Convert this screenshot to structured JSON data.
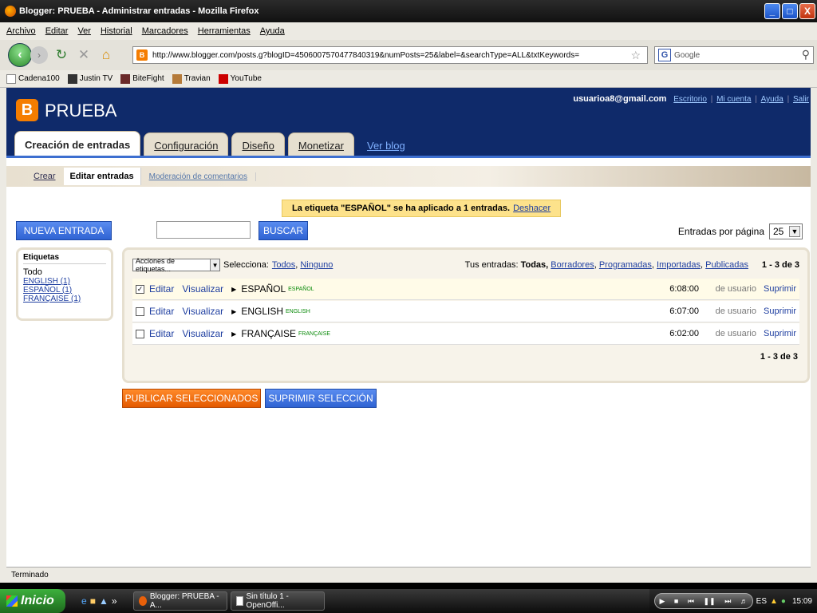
{
  "window": {
    "title": "Blogger: PRUEBA - Administrar entradas - Mozilla Firefox",
    "minimize": "_",
    "maximize": "□",
    "close": "X"
  },
  "menu": [
    "Archivo",
    "Editar",
    "Ver",
    "Historial",
    "Marcadores",
    "Herramientas",
    "Ayuda"
  ],
  "nav": {
    "url": "http://www.blogger.com/posts.g?blogID=4506007570477840319&numPosts=25&label=&searchType=ALL&txtKeywords=",
    "search_placeholder": "Google"
  },
  "bookmarks": [
    "Cadena100",
    "Justin TV",
    "BiteFight",
    "Travian",
    "YouTube"
  ],
  "blog": {
    "title": "PRUEBA",
    "user_email": "usuarioa8@gmail.com",
    "links": [
      "Escritorio",
      "Mi cuenta",
      "Ayuda",
      "Salir"
    ],
    "link_sep": "|"
  },
  "tabs": [
    "Creación de entradas",
    "Configuración",
    "Diseño",
    "Monetizar",
    "Ver blog"
  ],
  "subnav": [
    "Crear",
    "Editar entradas",
    "Moderación de comentarios"
  ],
  "notice": {
    "text": "La etiqueta \"ESPAÑOL\" se ha aplicado a 1 entradas.",
    "undo": "Deshacer"
  },
  "buttons": {
    "new_post": "NUEVA ENTRADA",
    "search": "BUSCAR",
    "publish_selected": "PUBLICAR SELECCIONADOS",
    "delete_selected": "SUPRIMIR SELECCIÓN"
  },
  "per_page": {
    "label": "Entradas por página",
    "value": "25"
  },
  "labels_box": {
    "header": "Etiquetas",
    "all": "Todo",
    "items": [
      "ENGLISH (1)",
      "ESPAÑOL (1)",
      "FRANÇAISE (1)"
    ]
  },
  "list": {
    "actions_select": "Acciones de etiquetas...",
    "select_label": "Selecciona:",
    "select_all": "Todos",
    "select_none": "Ninguno",
    "your_posts": "Tus entradas:",
    "filter_all": "Todas,",
    "filters": [
      "Borradores",
      "Programadas",
      "Importadas",
      "Publicadas"
    ],
    "count": "1 - 3 de 3",
    "edit": "Editar",
    "view": "Visualizar",
    "author": "de usuario",
    "delete": "Suprimir",
    "rows": [
      {
        "title": "ESPAÑOL",
        "label": "español",
        "time": "6:08:00",
        "checked": "✓"
      },
      {
        "title": "ENGLISH",
        "label": "english",
        "time": "6:07:00",
        "checked": ""
      },
      {
        "title": "FRANÇAISE",
        "label": "française",
        "time": "6:02:00",
        "checked": ""
      }
    ]
  },
  "statusbar": "Terminado",
  "taskbar": {
    "start": "Inicio",
    "tasks": [
      "Blogger: PRUEBA - A...",
      "Sin título 1 - OpenOffi..."
    ],
    "clock": "15:09"
  }
}
